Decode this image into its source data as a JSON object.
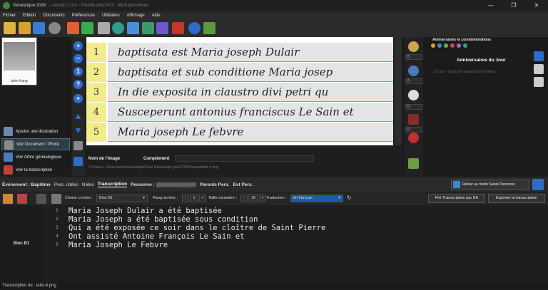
{
  "window": {
    "title": "Généatique 2026",
    "title_detail": "– version 1.0.4 – Famille plus7413 · 4610 personnes",
    "min": "—",
    "max": "❐",
    "close": "✕"
  },
  "menu": [
    "Fichier",
    "Edition",
    "Documents",
    "Préférences",
    "Utilitaires",
    "Affichage",
    "Aide"
  ],
  "thumbnail": {
    "caption": "latin-4.png"
  },
  "left_buttons": [
    {
      "label": "Ajouter une illustration",
      "icon": "image-icon"
    },
    {
      "label": "Voir Document / Photo",
      "icon": "document-icon"
    },
    {
      "label": "Voir Arbre généalogique",
      "icon": "tree-icon"
    },
    {
      "label": "Voir la transcription",
      "icon": "quill-icon"
    }
  ],
  "manuscript_lines": [
    {
      "num": "1",
      "text": "baptisata est Maria joseph Dulair"
    },
    {
      "num": "2",
      "text": "baptisata et sub conditione Maria josep"
    },
    {
      "num": "3",
      "text": "In die exposita in claustro divi petri qu"
    },
    {
      "num": "4",
      "text": "Susceperunt antonius franciscus Le Sain et"
    },
    {
      "num": "5",
      "text": "Maria joseph Le febvre"
    }
  ],
  "image_info": {
    "name_label": "Nom de l'image",
    "complement_label": "Complément",
    "path": "C:\\Users\\...\\Documents\\Généatique\\Fam Généalogie plus7413\\Images\\latin-4.png"
  },
  "anniversaries": {
    "title": "Anniversaires et commémorations",
    "subtitle": "Anniversaires du Jour",
    "entry": "53 ans · (jours de naissance) Christian ..."
  },
  "right_spinners": [
    "0",
    "0",
    "0",
    "0"
  ],
  "tabs": {
    "items": [
      "Événement : Baptême",
      "Pers. citées",
      "Notes",
      "Transcription",
      "Personne :",
      "Christian SAMAIN",
      "Parents Pers.",
      "Evt Pers."
    ],
    "active_index": 3,
    "return_button": "Retour au mode Saisie Personne"
  },
  "controls": {
    "choose_block_label": "Choisir un bloc :",
    "block_value": "Bloc B1",
    "rank_label": "Rang du bloc :",
    "rank_minus": "-",
    "rank_value": "1",
    "rank_plus": "+",
    "char_size_label": "Taille caractère :",
    "size_minus": "-",
    "size_value": "16",
    "size_plus": "+",
    "translation_label": "Traduction :",
    "translation_value": "en français",
    "ia_button": "Pré-Transcription par l'IA",
    "export_button": "Exporter la transcription"
  },
  "editor": {
    "block_label": "Bloc B1",
    "lines": [
      {
        "num": "1",
        "text": "Maria Joseph Dulair a été baptisée"
      },
      {
        "num": "2",
        "text": "Maria Joseph a été baptisée sous condition"
      },
      {
        "num": "3",
        "text": "Qui a été exposée ce soir dans le cloître de Saint Pierre"
      },
      {
        "num": "4",
        "text": "Ont assisté Antoine François Le Sain et"
      },
      {
        "num": "5",
        "text": "Maria Joseph Le Febvre"
      }
    ]
  },
  "status": "Transcription de : latin-4.png"
}
